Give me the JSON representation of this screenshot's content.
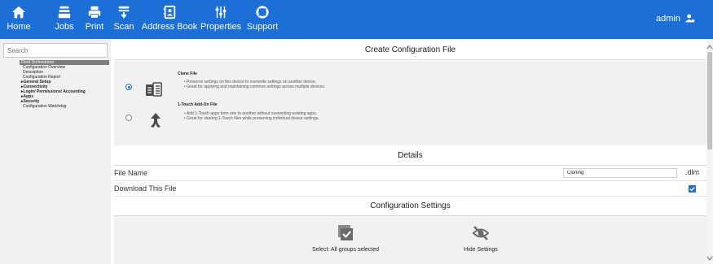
{
  "nav": {
    "items": [
      {
        "label": "Home",
        "icon": "home-icon"
      },
      {
        "label": "Jobs",
        "icon": "jobs-icon"
      },
      {
        "label": "Print",
        "icon": "print-icon"
      },
      {
        "label": "Scan",
        "icon": "scan-icon"
      },
      {
        "label": "Address Book",
        "icon": "address-book-icon"
      },
      {
        "label": "Properties",
        "icon": "properties-icon"
      },
      {
        "label": "Support",
        "icon": "support-icon"
      }
    ],
    "user": "admin"
  },
  "sidebar": {
    "search_placeholder": "Search",
    "items": [
      {
        "label": "Fleet Orchestrator",
        "selected": true
      },
      {
        "label": "Configuration Overview"
      },
      {
        "label": "Description"
      },
      {
        "label": "Configuration Report"
      },
      {
        "label": "▸General Setup"
      },
      {
        "label": "▸Connectivity"
      },
      {
        "label": "▸Login/ Permissions/ Accounting"
      },
      {
        "label": "▸Apps"
      },
      {
        "label": "▸Security"
      },
      {
        "label": "Configuration Watchdog"
      }
    ]
  },
  "create": {
    "title": "Create Configuration File",
    "options": [
      {
        "title": "Clone File",
        "selected": true,
        "bullets": [
          "Preserve settings on this device to overwrite settings on another device.",
          "Great for applying and maintaining common settings across multiple devices."
        ]
      },
      {
        "title": "1-Touch Add-On File",
        "selected": false,
        "bullets": [
          "Add 1-Touch apps from one to another without overwriting existing apps.",
          "Great for sharing 1-Touch files while preserving individual device settings."
        ]
      }
    ]
  },
  "details": {
    "title": "Details",
    "file_name_label": "File Name",
    "file_name_value": "Cloning",
    "file_suffix": ".dlm",
    "download_label": "Download This File",
    "download_checked": true
  },
  "config": {
    "title": "Configuration Settings",
    "select_label": "Select: All groups selected",
    "hide_label": "Hide Settings"
  },
  "colors": {
    "accent": "#1b6fd6",
    "panel": "#f1f1f1"
  }
}
